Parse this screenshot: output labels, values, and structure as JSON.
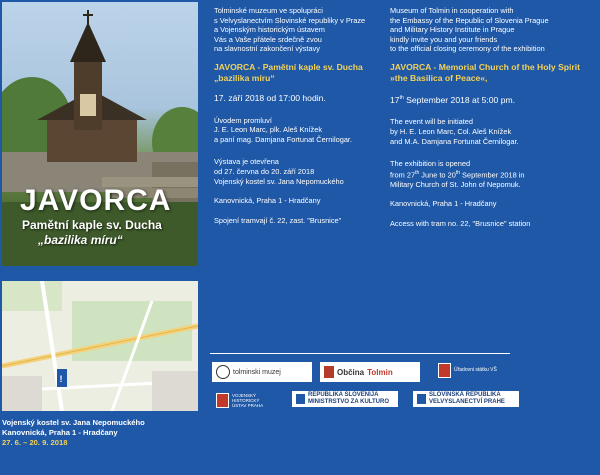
{
  "hero": {
    "title": "JAVORCA",
    "subtitle_1": "Pamětní kaple sv. Ducha",
    "subtitle_2": "„bazilika míru“"
  },
  "czech": {
    "intro": [
      "Tolminské muzeum ve spolupráci",
      "s Velvyslanectvím Slovinské republiky v Praze",
      "a Vojenským historickým ústavem",
      "Vás a Vaše přátele srdečně zvou",
      "na slavnostní zakončení výstavy"
    ],
    "heading_1": "JAVORCA - Pamětní kaple sv. Ducha",
    "heading_2": "„bazilika míru“",
    "date": "17. září 2018 od 17:00 hodin.",
    "speakers": [
      "Úvodem promluví",
      "J. E. Leon Marc, plk. Aleš Knížek",
      "a paní mag. Damjana Fortunat Černilogar."
    ],
    "exhibition": [
      "Výstava je otevřena",
      "od 27. června do 20. září 2018",
      "Vojenský kostel sv. Jana Nepomuckého"
    ],
    "address": "Kanovnická, Praha 1 - Hradčany",
    "transport": "Spojení tramvají č. 22, zast. \"Brusnice\""
  },
  "english": {
    "intro": [
      "Museum of Tolmin in cooperation with",
      "the Embassy of the Republic of Slovenia Prague",
      "and Military History Institute in Prague",
      "kindly invite you and your friends",
      "to the official closing ceremony of the exhibition"
    ],
    "heading_1": "JAVORCA - Memorial Church of the Holy Spirit",
    "heading_2": "»the Basilica of Peace«,",
    "date_day": "17",
    "date_sup": "th",
    "date_rest": " September 2018 at 5:00 pm.",
    "speakers": [
      "The event will be initiated",
      "by H. E. Leon Marc, Col. Aleš Knížek",
      "and M.A. Damjana Fortunat Černilogar."
    ],
    "exhibition_1": "The exhibition is opened",
    "exhibition_2_a": "from 27",
    "exhibition_2_sup1": "th",
    "exhibition_2_b": " June to 20",
    "exhibition_2_sup2": "th",
    "exhibition_2_c": " September 2018 in",
    "exhibition_3": "Military Church of St. John of Nepomuk.",
    "address": "Kanovnická, Praha 1 - Hradčany",
    "transport": "Access with tram no. 22, \"Brusnice\" station"
  },
  "caption": {
    "line_1": "Vojenský kostel sv. Jana Nepomuckého",
    "line_2": "Kanovnická, Praha 1 - Hradčany",
    "line_3": "27. 6. – 20. 9. 2018"
  },
  "logos": {
    "tolmin_museum": "tolminski muzej",
    "obcina": "Občina",
    "obcina_brand": "Tolmin",
    "army_office": "Úřadovni státku VŠ",
    "military_institute": [
      "VOJENSKÝ",
      "HISTORICKÝ",
      "ÚSTAV PRAHA"
    ],
    "ministry": [
      "REPUBLIKA SLOVENIJA",
      "MINISTRSTVO ZA KULTURO"
    ],
    "embassy": [
      "SLOVINSKÁ REPUBLIKA",
      "VELVYSLANECTVÍ PRAHE"
    ]
  },
  "colors": {
    "background": "#1f58a6",
    "accent": "#f3d25a"
  }
}
